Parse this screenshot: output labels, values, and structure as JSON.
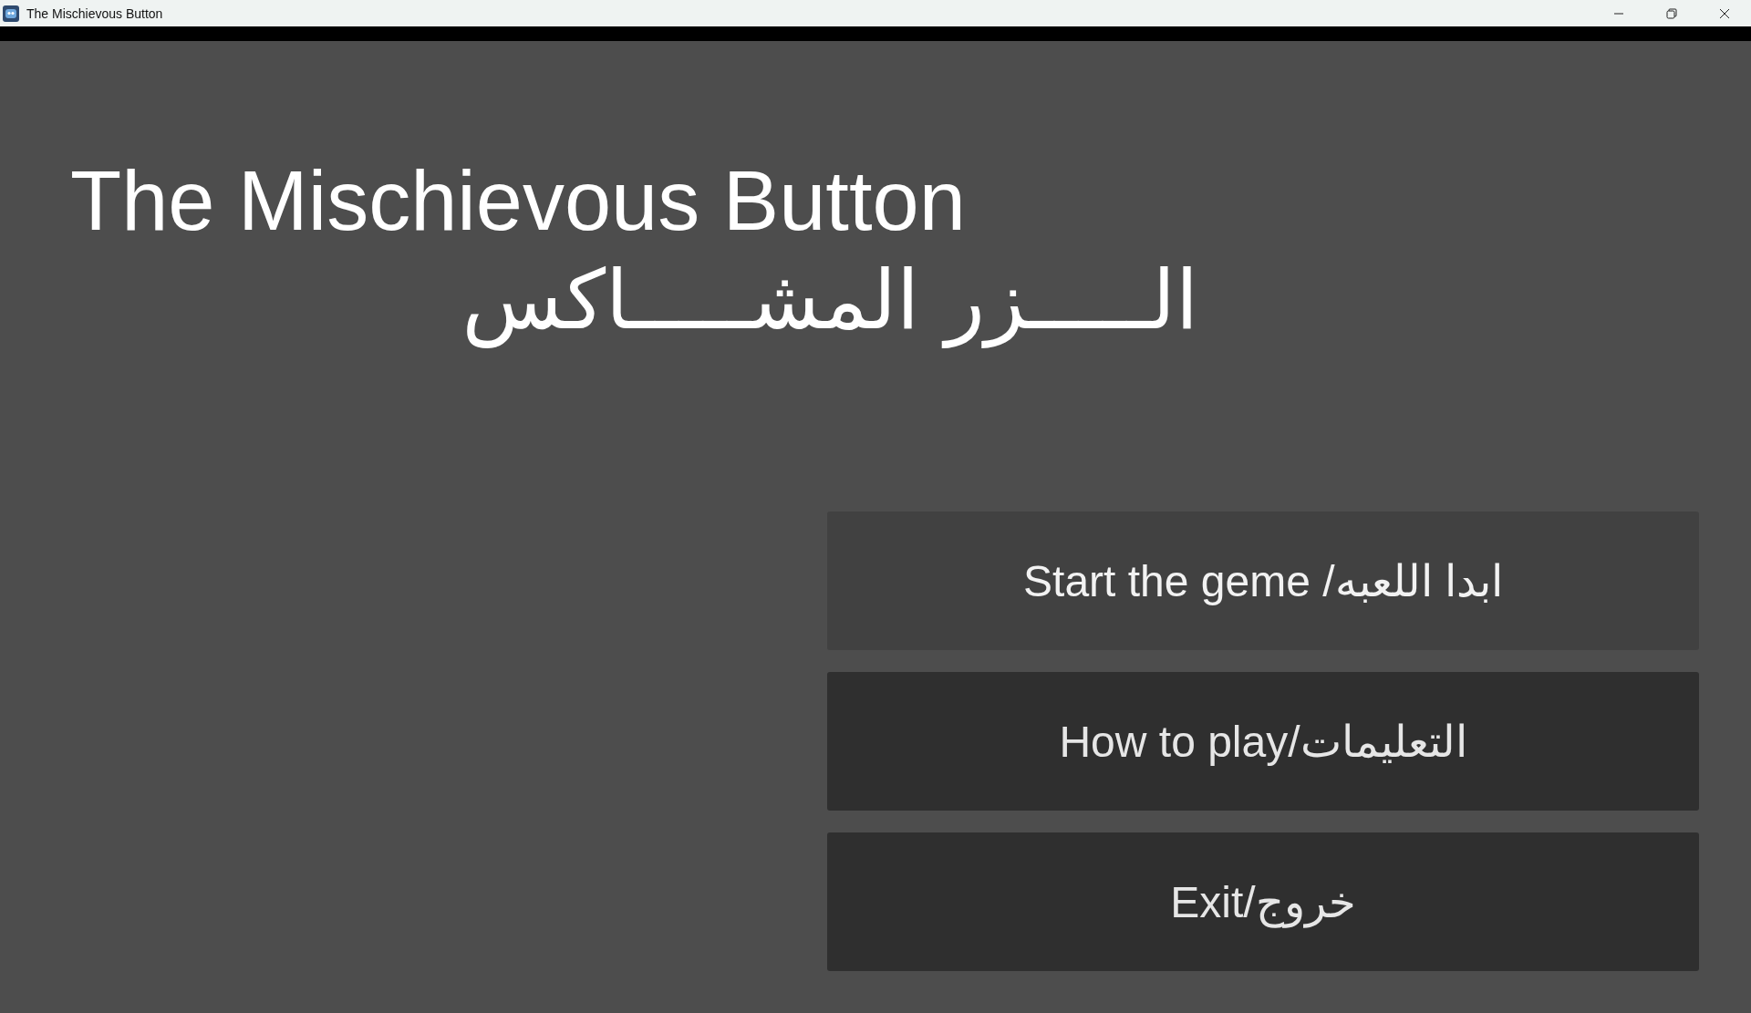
{
  "window": {
    "title": "The Mischievous Button"
  },
  "title": "The Mischievous Button",
  "subtitle": "الـــــزر المشـــــاكس",
  "buttons": [
    {
      "label": "Start the geme /ابدا اللعبه",
      "selected": true
    },
    {
      "label": "How to play/التعليمات",
      "selected": false
    },
    {
      "label": "Exit/خروج",
      "selected": false
    }
  ]
}
